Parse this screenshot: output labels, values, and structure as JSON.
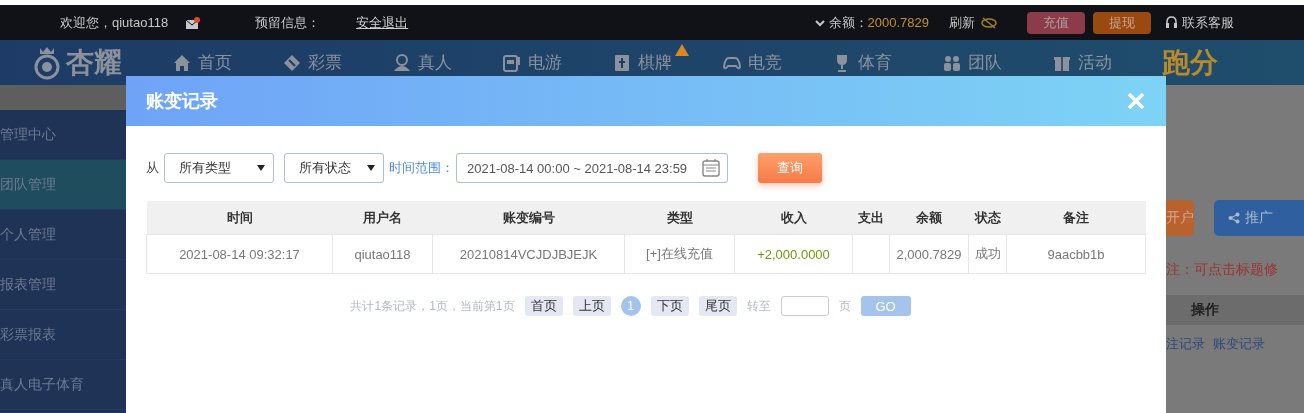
{
  "top_bar": {
    "welcome": "欢迎您，qiutao118",
    "has_unread": true,
    "reserved_info": "预留信息：",
    "logout": "安全退出",
    "balance_label": "余额：",
    "balance": "2000.7829",
    "refresh": "刷新",
    "recharge": "充值",
    "withdraw": "提现",
    "support": "联系客服"
  },
  "nav": {
    "logo": "杏耀",
    "items": [
      {
        "label": "首页",
        "kind": "normal"
      },
      {
        "label": "彩票",
        "kind": "normal"
      },
      {
        "label": "真人",
        "kind": "normal"
      },
      {
        "label": "电游",
        "kind": "normal"
      },
      {
        "label": "棋牌",
        "kind": "hot"
      },
      {
        "label": "电竞",
        "kind": "normal"
      },
      {
        "label": "体育",
        "kind": "normal"
      },
      {
        "label": "团队",
        "kind": "normal"
      },
      {
        "label": "活动",
        "kind": "normal"
      },
      {
        "label": "跑分",
        "kind": "promo"
      }
    ]
  },
  "sidebar": {
    "items": [
      {
        "label": "管理中心",
        "selected": false
      },
      {
        "label": "团队管理",
        "selected": true
      },
      {
        "label": "个人管理",
        "selected": false
      },
      {
        "label": "报表管理",
        "selected": false
      },
      {
        "label": "彩票报表",
        "selected": false
      },
      {
        "label": "真人电子体育",
        "selected": false
      }
    ]
  },
  "background_panel": {
    "buttons": [
      {
        "label": "开户",
        "color": "#b8622e"
      },
      {
        "label": "推广",
        "color": "#2f5f9e"
      }
    ],
    "note": "注：可点击标题修",
    "table_header": "操作",
    "links": [
      "注记录",
      "账变记录"
    ]
  },
  "modal": {
    "title": "账变记录",
    "filters": {
      "from_label": "从",
      "type_select": "所有类型",
      "status_select": "所有状态",
      "time_range_label": "时间范围：",
      "date_range": "2021-08-14 00:00 ~ 2021-08-14 23:59",
      "query_button": "查询"
    },
    "table": {
      "columns": [
        "时间",
        "用户名",
        "账变编号",
        "类型",
        "收入",
        "支出",
        "余额",
        "状态",
        "备注"
      ],
      "rows": [
        [
          "2021-08-14 09:32:17",
          "qiutao118",
          "20210814VCJDJBJEJK",
          "[+]在线充值",
          "+2,000.0000",
          "",
          "2,000.7829",
          "成功",
          "9aacbb1b"
        ]
      ]
    },
    "pagination": {
      "summary": "共计1条记录，1页，当前第1页",
      "first": "首页",
      "prev": "上页",
      "pages": [
        {
          "label": "1",
          "selected": true
        }
      ],
      "next": "下页",
      "last": "尾页",
      "goto_label": "转至",
      "page_unit": "页",
      "go": "GO"
    }
  }
}
